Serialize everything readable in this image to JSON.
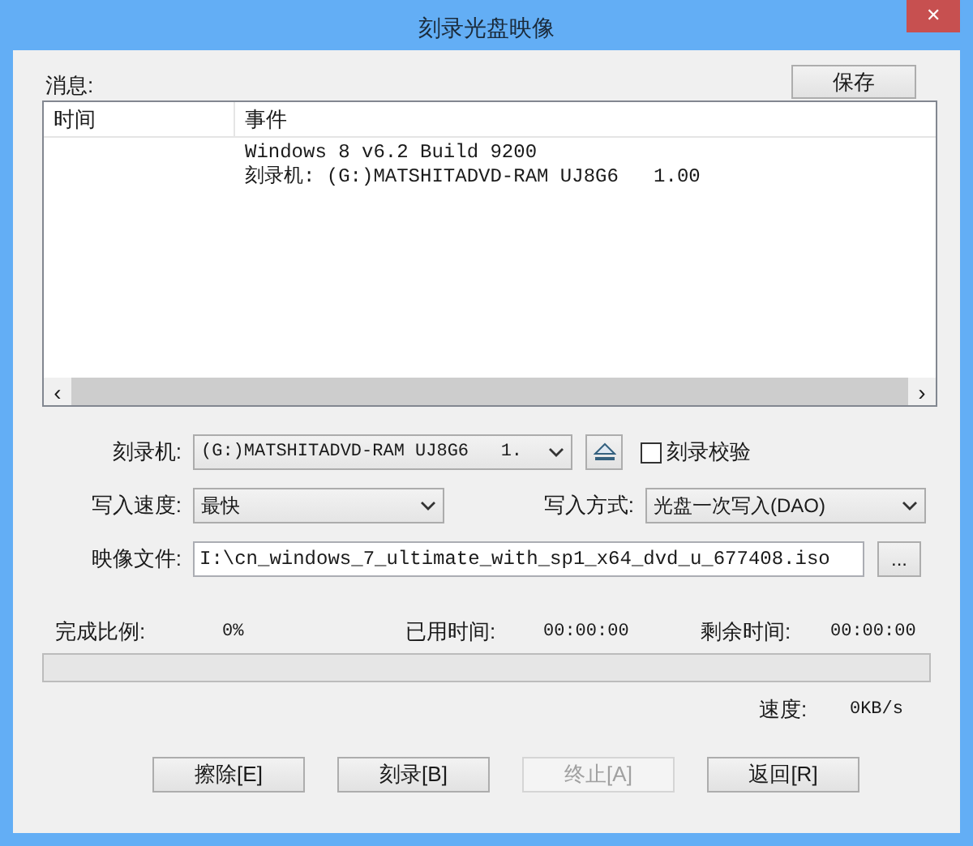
{
  "window": {
    "title": "刻录光盘映像",
    "close": "✕"
  },
  "messages": {
    "label": "消息:",
    "save_button": "保存",
    "columns": [
      "时间",
      "事件"
    ],
    "rows": [
      {
        "event": "Windows 8 v6.2 Build 9200"
      },
      {
        "event": "刻录机: (G:)MATSHITADVD-RAM UJ8G6   1.00"
      }
    ],
    "scroll_left": "‹",
    "scroll_right": "›"
  },
  "burner": {
    "label": "刻录机:",
    "value": "(G:)MATSHITADVD-RAM UJ8G6   1.",
    "verify": {
      "label": "刻录校验",
      "checked": false
    }
  },
  "speed": {
    "label": "写入速度:",
    "value": "最快"
  },
  "mode": {
    "label": "写入方式:",
    "value": "光盘一次写入(DAO)"
  },
  "image_file": {
    "label": "映像文件:",
    "value": "I:\\cn_windows_7_ultimate_with_sp1_x64_dvd_u_677408.iso",
    "browse": "..."
  },
  "progress": {
    "percent_label": "完成比例:",
    "percent": "0%",
    "elapsed_label": "已用时间:",
    "elapsed": "00:00:00",
    "remaining_label": "剩余时间:",
    "remaining": "00:00:00",
    "level": 0,
    "speed_label": "速度:",
    "speed": "0KB/s"
  },
  "buttons": [
    {
      "label": "擦除[E]",
      "disabled": false
    },
    {
      "label": "刻录[B]",
      "disabled": false
    },
    {
      "label": "终止[A]",
      "disabled": true
    },
    {
      "label": "返回[R]",
      "disabled": false
    }
  ]
}
